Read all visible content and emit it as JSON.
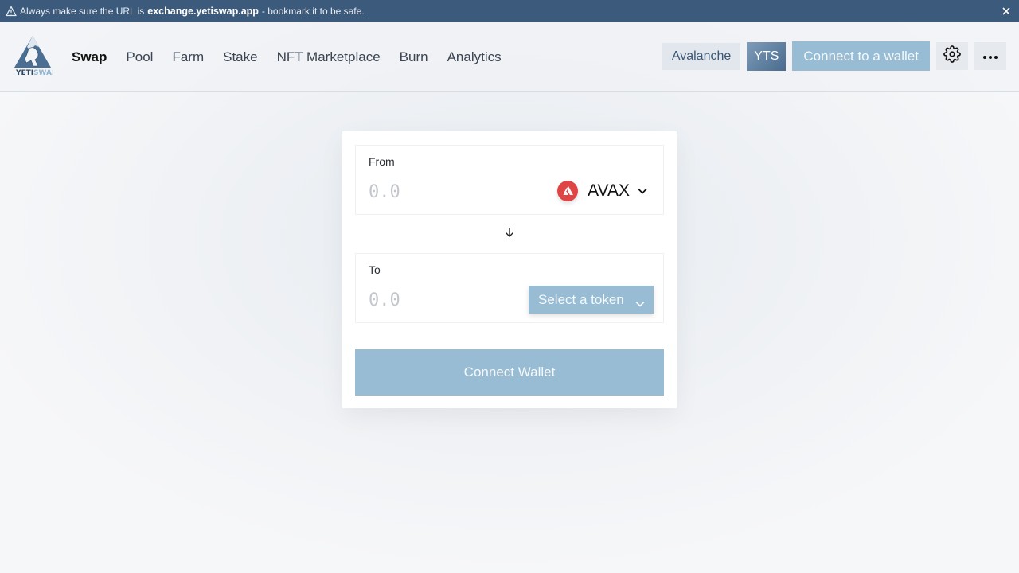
{
  "banner": {
    "prefix": "Always make sure the URL is",
    "url": "exchange.yetiswap.app",
    "suffix": "- bookmark it to be safe.",
    "icon": "warning-triangle-icon",
    "close_icon": "close-icon"
  },
  "header": {
    "logo": {
      "text_top": "YETI",
      "text_bottom": "SWAP"
    },
    "nav": [
      {
        "label": "Swap",
        "active": true
      },
      {
        "label": "Pool",
        "active": false
      },
      {
        "label": "Farm",
        "active": false
      },
      {
        "label": "Stake",
        "active": false
      },
      {
        "label": "NFT Marketplace",
        "active": false
      },
      {
        "label": "Burn",
        "active": false
      },
      {
        "label": "Analytics",
        "active": false
      }
    ],
    "network_label": "Avalanche",
    "token_label": "YTS",
    "connect_label": "Connect to a wallet",
    "settings_icon": "gear-icon",
    "more_icon": "more-dots-icon"
  },
  "swap": {
    "from": {
      "label": "From",
      "placeholder": "0.0",
      "token": "AVAX",
      "token_color": "#e04545"
    },
    "to": {
      "label": "To",
      "placeholder": "0.0",
      "select_label": "Select a token"
    },
    "connect_wallet_label": "Connect Wallet"
  },
  "colors": {
    "banner": "#3b5a7c",
    "accent": "#97bcd3",
    "yts": "#4a6b8e"
  }
}
